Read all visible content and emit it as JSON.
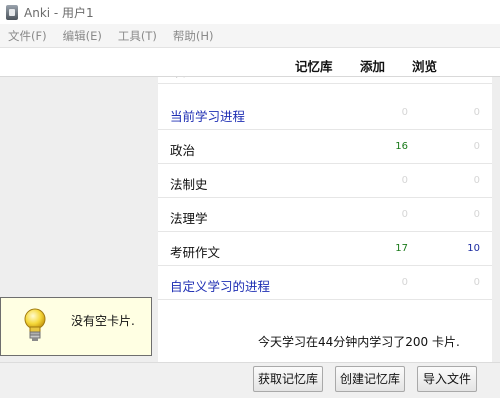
{
  "window": {
    "title": "Anki - 用户1"
  },
  "menu": [
    "文件(F)",
    "编辑(E)",
    "工具(T)",
    "帮助(H)"
  ],
  "columns": {
    "deck": "记忆库",
    "add": "添加",
    "browse": "浏览"
  },
  "partial_row": {
    "name": "军阀"
  },
  "decks": [
    {
      "name": "当前学习进程",
      "due": "0",
      "new": "0"
    },
    {
      "name": "政治",
      "due": "16",
      "new": "0"
    },
    {
      "name": "法制史",
      "due": "0",
      "new": "0"
    },
    {
      "name": "法理学",
      "due": "0",
      "new": "0"
    },
    {
      "name": "考研作文",
      "due": "17",
      "new": "10"
    },
    {
      "name": "自定义学习的进程",
      "due": "0",
      "new": "0"
    }
  ],
  "stats": "今天学习在44分钟内学习了200 卡片.",
  "tooltip": {
    "text": "没有空卡片.",
    "icon": "lightbulb-icon"
  },
  "buttons": {
    "get_shared": "获取记忆库",
    "create_deck": "创建记忆库",
    "import": "导入文件"
  },
  "colors": {
    "link": "#1f2fb4",
    "green": "#1a7a1a",
    "blue": "#1a2aa0",
    "zero": "#d6d6d6",
    "tooltip_bg": "#ffffe3"
  }
}
